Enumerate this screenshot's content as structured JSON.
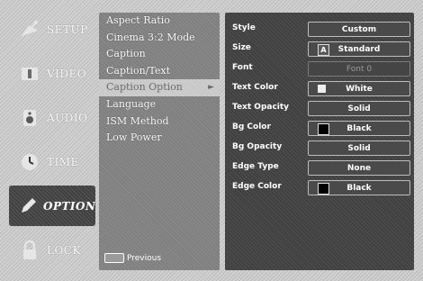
{
  "nav": [
    {
      "id": "setup",
      "label": "SETUP",
      "icon": "satellite-dish-icon",
      "active": false
    },
    {
      "id": "video",
      "label": "VIDEO",
      "icon": "video-panel-icon",
      "active": false
    },
    {
      "id": "audio",
      "label": "AUDIO",
      "icon": "speaker-icon",
      "active": false
    },
    {
      "id": "time",
      "label": "TIME",
      "icon": "clock-icon",
      "active": false
    },
    {
      "id": "option",
      "label": "OPTION",
      "icon": "pencil-icon",
      "active": true
    },
    {
      "id": "lock",
      "label": "LOCK",
      "icon": "padlock-icon",
      "active": false
    }
  ],
  "menu": {
    "items": [
      "Aspect Ratio",
      "Cinema 3:2 Mode",
      "Caption",
      "Caption/Text",
      "Caption Option",
      "Language",
      "ISM Method",
      "Low Power"
    ],
    "selected_index": 4,
    "previous_label": "Previous"
  },
  "settings": {
    "rows": [
      {
        "label": "Style",
        "value": "Custom",
        "swatch": null,
        "enabled": true
      },
      {
        "label": "Size",
        "value": "Standard",
        "swatch": "A",
        "enabled": true
      },
      {
        "label": "Font",
        "value": "Font 0",
        "swatch": null,
        "enabled": false
      },
      {
        "label": "Text Color",
        "value": "White",
        "swatch": "white",
        "enabled": true
      },
      {
        "label": "Text Opacity",
        "value": "Solid",
        "swatch": null,
        "enabled": true
      },
      {
        "label": "Bg Color",
        "value": "Black",
        "swatch": "black",
        "enabled": true
      },
      {
        "label": "Bg Opacity",
        "value": "Solid",
        "swatch": null,
        "enabled": true
      },
      {
        "label": "Edge Type",
        "value": "None",
        "swatch": null,
        "enabled": true
      },
      {
        "label": "Edge Color",
        "value": "Black",
        "swatch": "black",
        "enabled": true
      }
    ]
  },
  "colors": {
    "active_tab": "#404040",
    "menu_panel": "#808080",
    "settings_panel": "#404040",
    "selected_item": "#c8c8c8"
  }
}
